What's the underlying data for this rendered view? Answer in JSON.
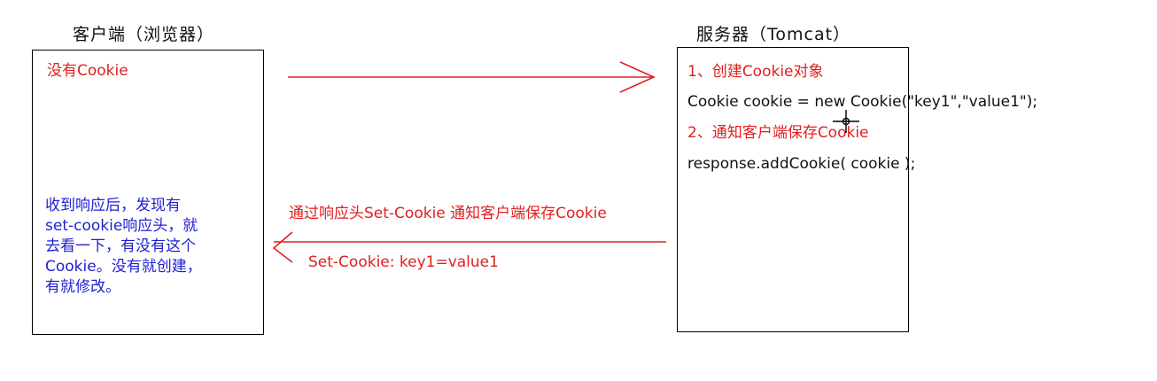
{
  "client": {
    "title": "客户端（浏览器）",
    "no_cookie": "没有Cookie",
    "note": "收到响应后，发现有\nset-cookie响应头，就\n去看一下，有没有这个\nCookie。没有就创建，\n有就修改。"
  },
  "server": {
    "title": "服务器（Tomcat）",
    "step1": "1、创建Cookie对象",
    "code1": "Cookie cookie = new Cookie(\"key1\",\"value1\");",
    "step2": "2、通知客户端保存Cookie",
    "code2": "response.addCookie( cookie );"
  },
  "response_arrow": {
    "label": "通过响应头Set-Cookie 通知客户端保存Cookie",
    "header": "Set-Cookie: key1=value1"
  },
  "colors": {
    "red": "#e02020",
    "blue": "#2020d0",
    "black": "#111111"
  }
}
